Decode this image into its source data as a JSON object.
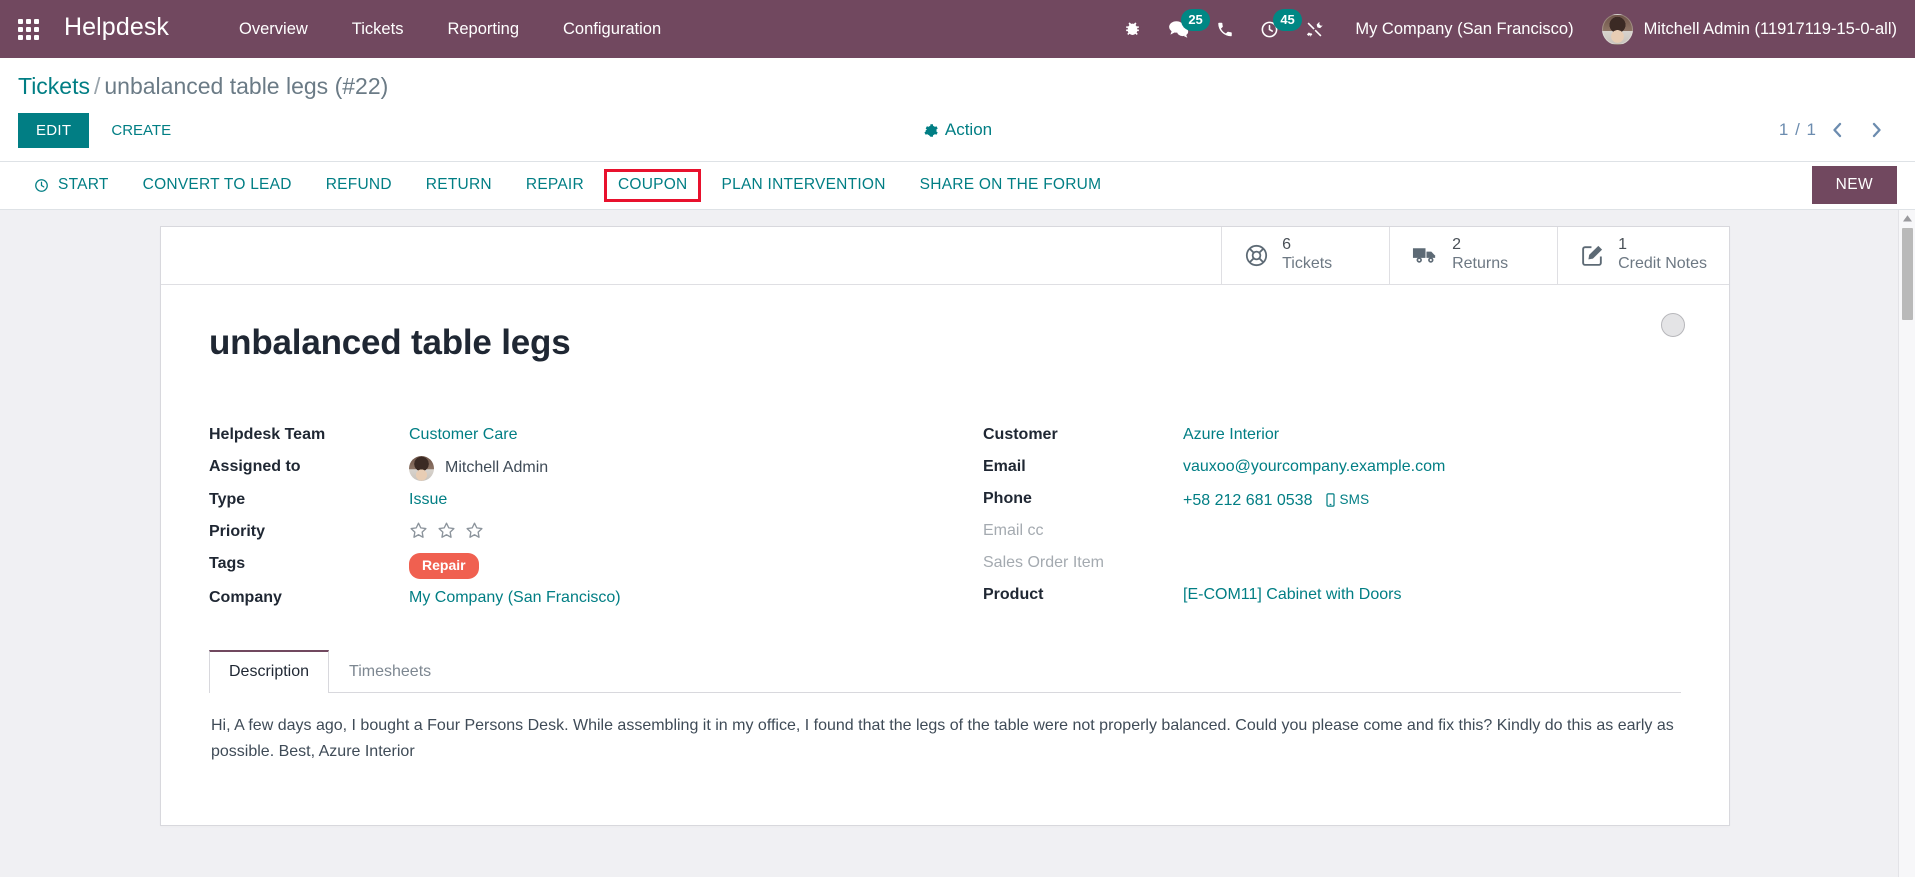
{
  "navbar": {
    "apps_icon": "apps-grid-icon",
    "brand": "Helpdesk",
    "menu": [
      {
        "label": "Overview"
      },
      {
        "label": "Tickets"
      },
      {
        "label": "Reporting"
      },
      {
        "label": "Configuration"
      }
    ],
    "sys_icons": [
      {
        "name": "bug-icon",
        "badge": null
      },
      {
        "name": "messages-icon",
        "badge": "25"
      },
      {
        "name": "phone-icon",
        "badge": null
      },
      {
        "name": "activities-clock-icon",
        "badge": "45"
      },
      {
        "name": "tools-icon",
        "badge": null
      }
    ],
    "company": "My Company (San Francisco)",
    "user": "Mitchell Admin (11917119-15-0-all)",
    "bg_color": "#71485f",
    "badge_color": "#008784"
  },
  "control_panel": {
    "breadcrumb_root": "Tickets",
    "breadcrumb_sep": "/",
    "breadcrumb_current": "unbalanced table legs (#22)",
    "edit_label": "EDIT",
    "create_label": "CREATE",
    "action_label": "Action",
    "pager_value": "1 / 1",
    "prev_label": "‹",
    "next_label": "›",
    "accent_color": "#017e84"
  },
  "statusbar": {
    "buttons": [
      {
        "label": "START",
        "icon": "clock-icon",
        "highlighted": false
      },
      {
        "label": "CONVERT TO LEAD",
        "icon": null,
        "highlighted": false
      },
      {
        "label": "REFUND",
        "icon": null,
        "highlighted": false
      },
      {
        "label": "RETURN",
        "icon": null,
        "highlighted": false
      },
      {
        "label": "REPAIR",
        "icon": null,
        "highlighted": false
      },
      {
        "label": "COUPON",
        "icon": null,
        "highlighted": true
      },
      {
        "label": "PLAN INTERVENTION",
        "icon": null,
        "highlighted": false
      },
      {
        "label": "SHARE ON THE FORUM",
        "icon": null,
        "highlighted": false
      }
    ],
    "status_current": "NEW",
    "highlight_color": "#e8112d",
    "status_color": "#71485f"
  },
  "stat_buttons": [
    {
      "icon": "life-ring-icon",
      "value": "6",
      "label": "Tickets"
    },
    {
      "icon": "truck-icon",
      "value": "2",
      "label": "Returns"
    },
    {
      "icon": "pencil-square-icon",
      "value": "1",
      "label": "Credit Notes"
    }
  ],
  "record": {
    "title": "unbalanced table legs",
    "kanban_state": "grey"
  },
  "fields_left": [
    {
      "label": "Helpdesk Team",
      "value": "Customer Care",
      "kind": "link"
    },
    {
      "label": "Assigned to",
      "value": "Mitchell Admin",
      "kind": "avatar"
    },
    {
      "label": "Type",
      "value": "Issue",
      "kind": "link"
    },
    {
      "label": "Priority",
      "value": "",
      "kind": "stars",
      "stars_total": 3,
      "stars_filled": 0
    },
    {
      "label": "Tags",
      "value": "Repair",
      "kind": "tag",
      "tag_color": "#f06050"
    },
    {
      "label": "Company",
      "value": "My Company (San Francisco)",
      "kind": "link"
    }
  ],
  "fields_right": [
    {
      "label": "Customer",
      "value": "Azure Interior",
      "kind": "link",
      "muted_label": false
    },
    {
      "label": "Email",
      "value": "vauxoo@yourcompany.example.com",
      "kind": "link",
      "muted_label": false
    },
    {
      "label": "Phone",
      "value": "+58 212 681 0538",
      "kind": "phone",
      "sms_label": "SMS",
      "muted_label": false
    },
    {
      "label": "Email cc",
      "value": "",
      "kind": "empty",
      "muted_label": true
    },
    {
      "label": "Sales Order Item",
      "value": "",
      "kind": "empty",
      "muted_label": true
    },
    {
      "label": "Product",
      "value": "[E-COM11] Cabinet with Doors",
      "kind": "link",
      "muted_label": false
    }
  ],
  "notebook": {
    "tabs": [
      {
        "label": "Description",
        "active": true
      },
      {
        "label": "Timesheets",
        "active": false
      }
    ],
    "description": "Hi, A few days ago, I bought a Four Persons Desk. While assembling it in my office, I found that the legs of the table were not properly balanced. Could you please come and fix this? Kindly do this as early as possible. Best, Azure Interior"
  }
}
